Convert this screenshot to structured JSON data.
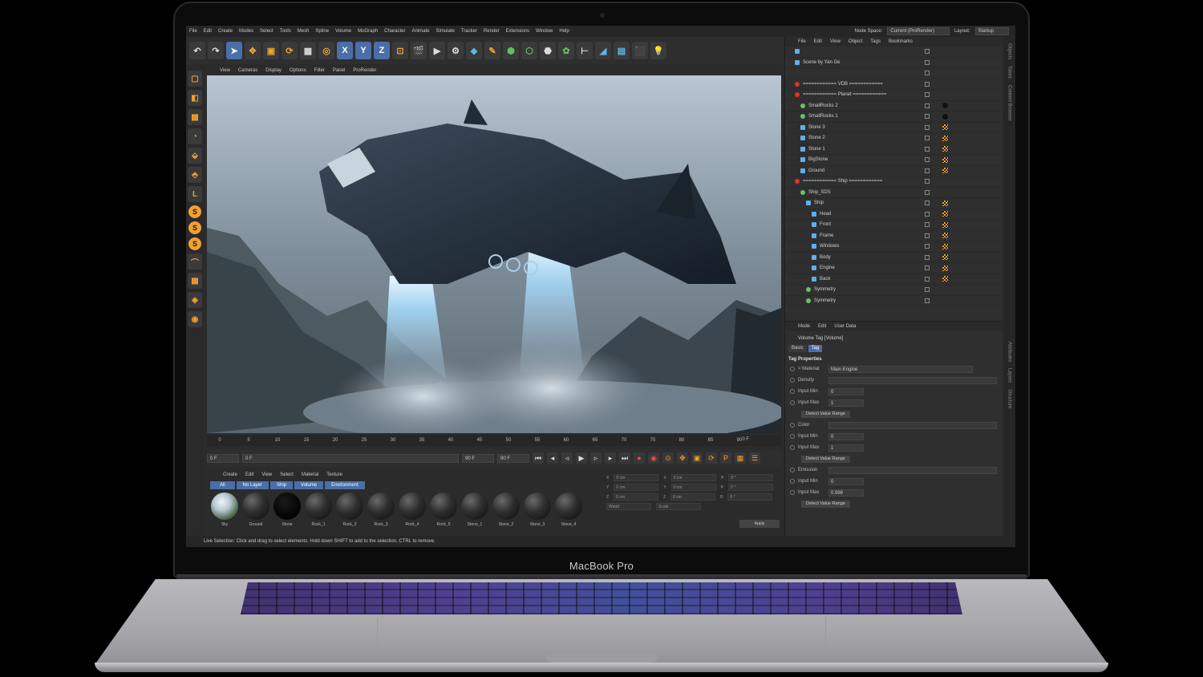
{
  "device": {
    "label": "MacBook Pro"
  },
  "menubar": {
    "items": [
      "File",
      "Edit",
      "Create",
      "Modes",
      "Select",
      "Tools",
      "Mesh",
      "Spline",
      "Volume",
      "MoGraph",
      "Character",
      "Animate",
      "Simulate",
      "Tracker",
      "Render",
      "Extensions",
      "Window",
      "Help"
    ],
    "node_space_label": "Node Space:",
    "node_space_value": "Current (ProRender)",
    "layout_label": "Layout:",
    "layout_value": "Startup"
  },
  "toolbar": {
    "axis_x": "X",
    "axis_y": "Y",
    "axis_z": "Z"
  },
  "viewport_menu": [
    "View",
    "Cameras",
    "Display",
    "Options",
    "Filter",
    "Panel",
    "ProRender"
  ],
  "timeline": {
    "ticks": [
      "0",
      "5",
      "10",
      "15",
      "20",
      "25",
      "30",
      "35",
      "40",
      "45",
      "50",
      "55",
      "60",
      "65",
      "70",
      "75",
      "80",
      "85",
      "90"
    ],
    "end_frame_label": "0 F",
    "current": "0 F",
    "start": "0 F",
    "end": "90 F",
    "max": "90 F"
  },
  "material_manager": {
    "menu": [
      "Create",
      "Edit",
      "View",
      "Select",
      "Material",
      "Texture"
    ],
    "tabs": [
      "All",
      "No Layer",
      "Ship",
      "Volume",
      "Environment"
    ],
    "materials": [
      "Sky",
      "Ground",
      "Stone",
      "Rock_1",
      "Rock_2",
      "Rock_3",
      "Rock_4",
      "Rock_5",
      "Stone_1",
      "Stone_2",
      "Stone_3",
      "Stone_4"
    ]
  },
  "coordinates": {
    "rows": [
      {
        "a": "X",
        "av": "0 cm",
        "b": "X",
        "bv": "0 cm",
        "c": "H",
        "cv": "0 °"
      },
      {
        "a": "Y",
        "av": "0 cm",
        "b": "Y",
        "bv": "0 cm",
        "c": "P",
        "cv": "0 °"
      },
      {
        "a": "Z",
        "av": "0 cm",
        "b": "Z",
        "bv": "0 cm",
        "c": "B",
        "cv": "0 °"
      }
    ],
    "mode": "World",
    "scale": "Scale",
    "apply": "Apply"
  },
  "status": "Live Selection: Click and drag to select elements. Hold down SHIFT to add to the selection, CTRL to remove.",
  "object_manager": {
    "menu": [
      "File",
      "Edit",
      "View",
      "Object",
      "Tags",
      "Bookmarks"
    ],
    "rows": [
      {
        "name": "",
        "kind": "ico",
        "indent": 0
      },
      {
        "name": "Scene by Yan Ge",
        "kind": "ico",
        "indent": 0
      },
      {
        "name": "",
        "kind": "none",
        "indent": 0
      },
      {
        "name": "============ VDB ============",
        "kind": "flag",
        "indent": 0
      },
      {
        "name": "============ Planet ============",
        "kind": "flag",
        "indent": 0
      },
      {
        "name": "SmallRocks 2",
        "kind": "grn",
        "indent": 1
      },
      {
        "name": "SmallRocks 1",
        "kind": "grn",
        "indent": 1
      },
      {
        "name": "Stone 3",
        "kind": "ico",
        "indent": 1
      },
      {
        "name": "Stone 2",
        "kind": "ico",
        "indent": 1
      },
      {
        "name": "Stone 1",
        "kind": "ico",
        "indent": 1
      },
      {
        "name": "BigStone",
        "kind": "ico",
        "indent": 1
      },
      {
        "name": "Ground",
        "kind": "ico",
        "indent": 1
      },
      {
        "name": "============ Ship ============",
        "kind": "flag",
        "indent": 0
      },
      {
        "name": "Ship_SDS",
        "kind": "grn",
        "indent": 1
      },
      {
        "name": "Ship",
        "kind": "ico",
        "indent": 2
      },
      {
        "name": "Head",
        "kind": "ico",
        "indent": 3
      },
      {
        "name": "Front",
        "kind": "ico",
        "indent": 3
      },
      {
        "name": "Frame",
        "kind": "ico",
        "indent": 3
      },
      {
        "name": "Windows",
        "kind": "ico",
        "indent": 3
      },
      {
        "name": "Body",
        "kind": "ico",
        "indent": 3
      },
      {
        "name": "Engine",
        "kind": "ico",
        "indent": 3
      },
      {
        "name": "Back",
        "kind": "ico",
        "indent": 3
      },
      {
        "name": "Symmetry",
        "kind": "grn",
        "indent": 2
      },
      {
        "name": "Symmetry",
        "kind": "grn",
        "indent": 2
      }
    ]
  },
  "side_tabs": [
    "Objects",
    "Takes",
    "Content Browser"
  ],
  "attr_side_tabs": [
    "Attributes",
    "Layers",
    "Structure"
  ],
  "attributes": {
    "menu": [
      "Mode",
      "Edit",
      "User Data"
    ],
    "title": "Volume Tag [Volume]",
    "tabs": [
      "Basic",
      "Tag"
    ],
    "section": "Tag Properties",
    "material_label": "> Material",
    "material_value": "Main Engine",
    "groups": [
      {
        "label": "Density",
        "min": "0",
        "max": "1"
      },
      {
        "label": "Color",
        "min": "0",
        "max": "1"
      },
      {
        "label": "Emission",
        "min": "0",
        "max": "0.998"
      }
    ],
    "input_min_label": "Input Min",
    "input_max_label": "Input Max",
    "detect_label": "Detect Value Range"
  }
}
